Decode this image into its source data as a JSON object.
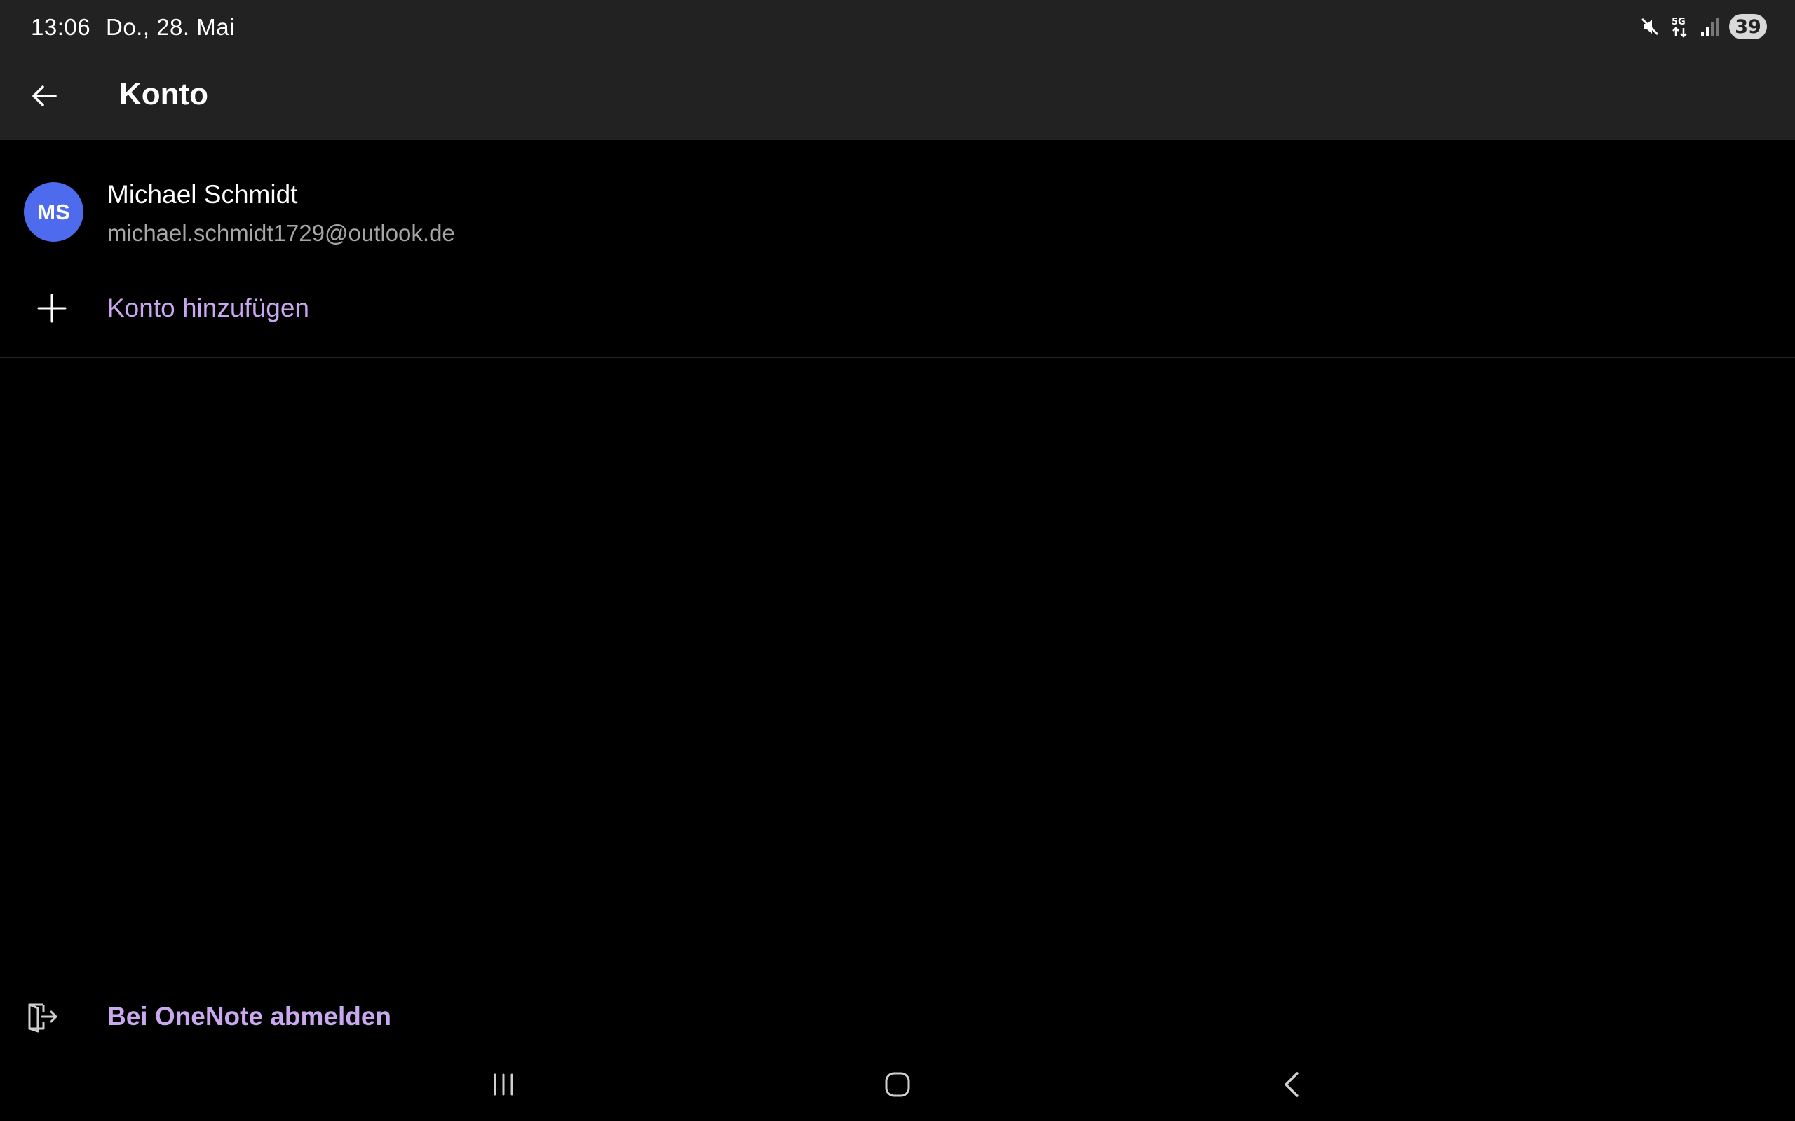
{
  "status_bar": {
    "time": "13:06",
    "date": "Do., 28. Mai",
    "icons": [
      "mute-icon",
      "5g-icon",
      "signal-icon"
    ],
    "battery": "39"
  },
  "app_bar": {
    "back_icon": "arrow-left-icon",
    "title": "Konto"
  },
  "account": {
    "initials": "MS",
    "name": "Michael Schmidt",
    "email": "michael.schmidt1729@outlook.de",
    "avatar_color": "#4f6bed"
  },
  "add_account": {
    "icon": "plus-icon",
    "label": "Konto hinzufügen"
  },
  "sign_out": {
    "icon": "sign-out-icon",
    "label": "Bei OneNote abmelden"
  },
  "nav_bar": {
    "buttons": [
      "recent-apps-icon",
      "home-icon",
      "back-icon"
    ]
  },
  "colors": {
    "accent": "#c9a8f0",
    "bar_background": "#222222",
    "background": "#000000"
  }
}
